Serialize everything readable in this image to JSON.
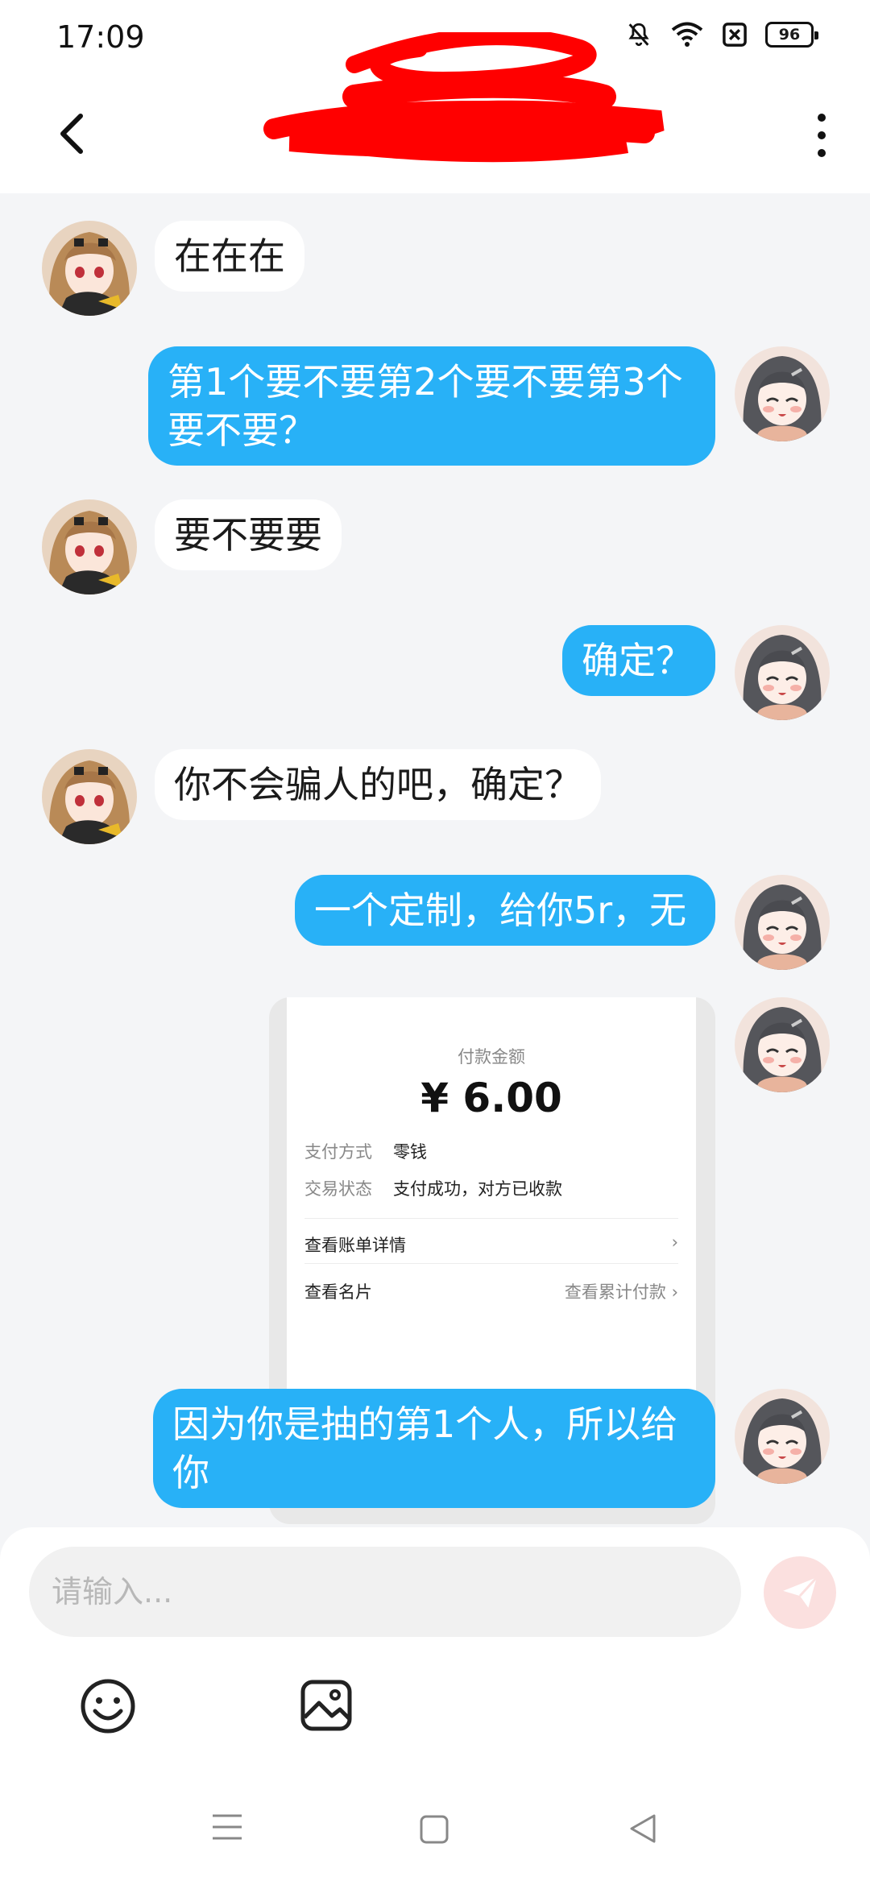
{
  "status_bar": {
    "time": "17:09",
    "battery": "96"
  },
  "header": {
    "title_redacted": true
  },
  "messages": [
    {
      "side": "left",
      "text": "在在在"
    },
    {
      "side": "right",
      "text_lines": [
        "第1个要不要第2个要不要第3个",
        "要不要？"
      ]
    },
    {
      "side": "left",
      "text": "要不要要"
    },
    {
      "side": "right",
      "text": "确定？"
    },
    {
      "side": "left",
      "text": "你不会骗人的吧，确定？"
    },
    {
      "side": "right",
      "text": "一个定制，给你5r，无"
    },
    {
      "side": "right",
      "text_lines": [
        "因为你是抽的第1个人，所以给",
        "你"
      ]
    }
  ],
  "payment_card": {
    "label": "付款金额",
    "amount": "¥ 6.00",
    "method_key": "支付方式",
    "method_value": "零钱",
    "status_key": "交易状态",
    "status_value": "支付成功，对方已收款",
    "bill_link": "查看账单详情",
    "card_link": "查看名片",
    "cumulative_link": "查看累计付款"
  },
  "input": {
    "placeholder": "请输入..."
  },
  "colors": {
    "accent_blue": "#28b1f7",
    "background": "#f4f5f7",
    "send_button": "#fbe0df",
    "redaction": "#ff0000"
  },
  "icons": [
    "back-icon",
    "more-icon",
    "mute-bell-icon",
    "wifi-icon",
    "sim-off-icon",
    "battery-icon",
    "send-icon",
    "emoji-icon",
    "image-icon",
    "nav-menu-icon",
    "nav-home-icon",
    "nav-back-icon"
  ]
}
